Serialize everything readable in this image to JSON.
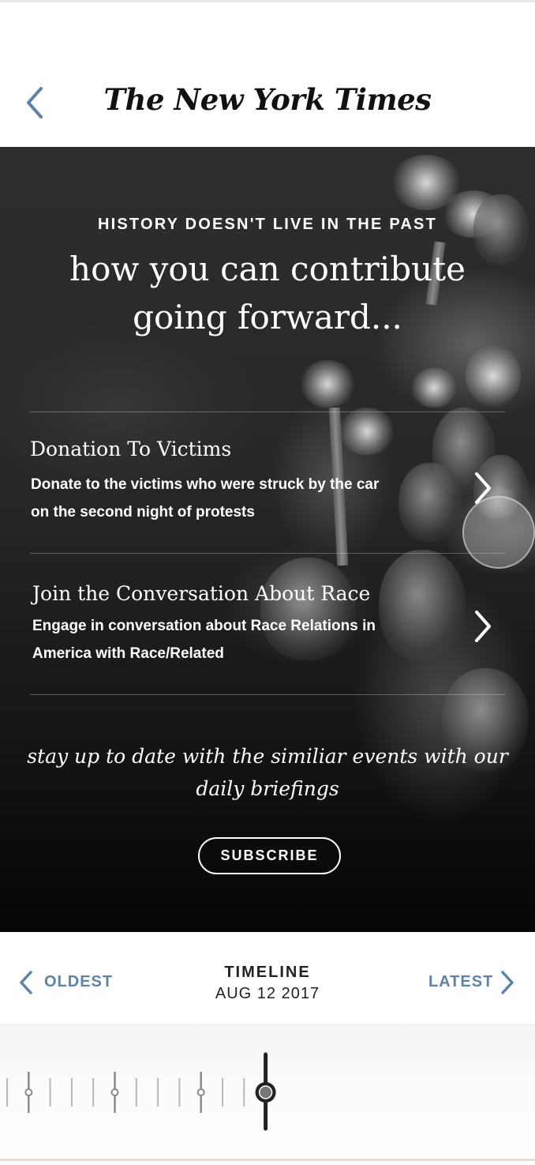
{
  "header": {
    "logo_text": "The New York Times",
    "back_icon": "chevron-left-icon",
    "accent_color": "#5d83a8"
  },
  "hero": {
    "eyebrow": "HISTORY DOESN'T LIVE IN THE PAST",
    "headline": "how you can contribute going forward...",
    "items": [
      {
        "title": "Donation To Victims",
        "description": "Donate to the victims who were struck by the car on the second night of protests",
        "icon": "chevron-right-icon"
      },
      {
        "title": "Join the Conversation About Race",
        "description": "Engage in conversation about Race Relations in America with Race/Related",
        "icon": "chevron-right-icon"
      }
    ],
    "cta_text": "stay up to date with the similiar events with our daily briefings",
    "subscribe_label": "SUBSCRIBE"
  },
  "timeline": {
    "oldest_label": "OLDEST",
    "latest_label": "LATEST",
    "title": "TIMELINE",
    "date": "AUG 12 2017"
  },
  "scrubber": {
    "tick_count": 13,
    "major_ticks": [
      1,
      5,
      9
    ],
    "selected_tick": 12
  }
}
